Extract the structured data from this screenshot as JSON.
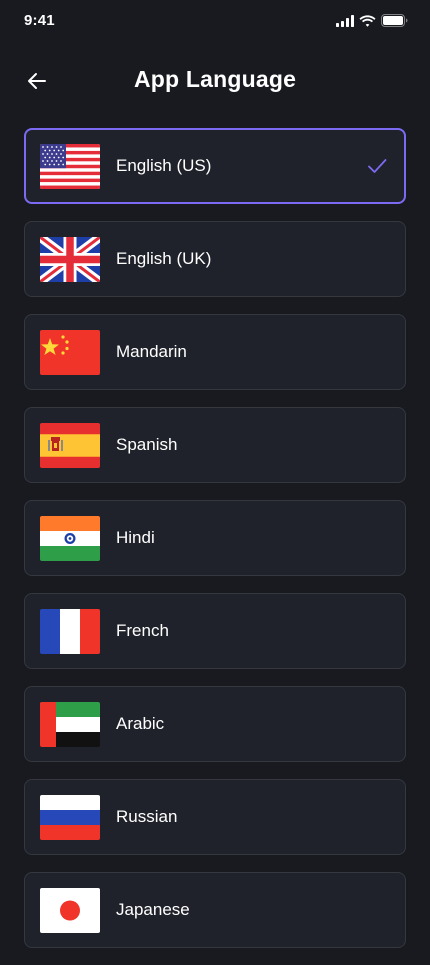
{
  "status_bar": {
    "time": "9:41",
    "icons": [
      "cellular-signal-icon",
      "wifi-icon",
      "battery-icon"
    ]
  },
  "header": {
    "title": "App Language",
    "back_icon": "arrow-left-icon"
  },
  "languages": [
    {
      "label": "English (US)",
      "flag": "us-flag-icon",
      "selected": true
    },
    {
      "label": "English (UK)",
      "flag": "uk-flag-icon",
      "selected": false
    },
    {
      "label": "Mandarin",
      "flag": "china-flag-icon",
      "selected": false
    },
    {
      "label": "Spanish",
      "flag": "spain-flag-icon",
      "selected": false
    },
    {
      "label": "Hindi",
      "flag": "india-flag-icon",
      "selected": false
    },
    {
      "label": "French",
      "flag": "france-flag-icon",
      "selected": false
    },
    {
      "label": "Arabic",
      "flag": "uae-flag-icon",
      "selected": false
    },
    {
      "label": "Russian",
      "flag": "russia-flag-icon",
      "selected": false
    },
    {
      "label": "Japanese",
      "flag": "japan-flag-icon",
      "selected": false
    }
  ],
  "colors": {
    "background": "#181a20",
    "card": "#1f222a",
    "card_border": "#35383f",
    "accent": "#7c6af2",
    "text": "#ffffff"
  }
}
